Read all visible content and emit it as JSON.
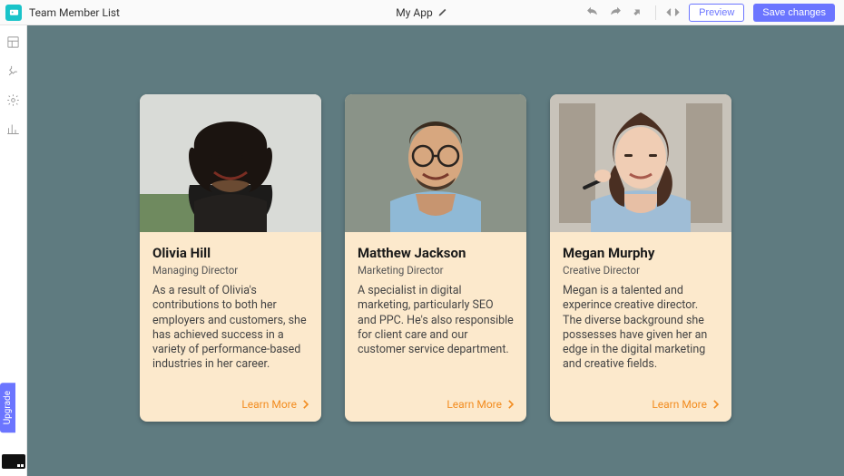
{
  "topbar": {
    "page_title": "Team Member List",
    "app_name": "My App",
    "preview_label": "Preview",
    "save_label": "Save changes"
  },
  "sidebar": {
    "upgrade_label": "Upgrade"
  },
  "cards": [
    {
      "name": "Olivia Hill",
      "role": "Managing Director",
      "bio": "As a result of Olivia's contributions to both her employers and customers, she has achieved success in a variety of performance-based industries in her career.",
      "cta": "Learn More"
    },
    {
      "name": "Matthew Jackson",
      "role": "Marketing Director",
      "bio": "A specialist in digital marketing, particularly SEO and PPC. He's also responsible for client care and our customer service department.",
      "cta": "Learn More"
    },
    {
      "name": "Megan Murphy",
      "role": "Creative Director",
      "bio": "Megan is a talented and experince creative director. The diverse background she possesses have given her an edge in the digital marketing and creative fields.",
      "cta": "Learn More"
    }
  ]
}
